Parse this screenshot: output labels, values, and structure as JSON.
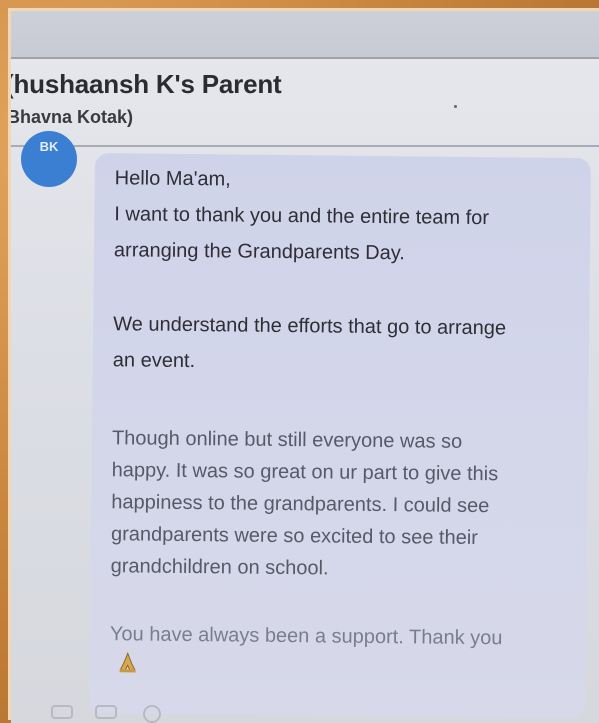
{
  "chat": {
    "name": "(hushaansh K's Parent",
    "subname": "Bhavna Kotak)",
    "avatar_initials": "BK"
  },
  "message": {
    "lines": [
      "Hello Ma'am,",
      "I want to thank you and the entire team for",
      "arranging the Grandparents Day.",
      "We understand the efforts that go to arrange",
      "an event.",
      "Though online but still everyone was so",
      "happy. It was so great on ur part to give this",
      "happiness to the grandparents. I could see",
      "grandparents were so excited to see their",
      "grandchildren on school.",
      "You have always been a support. Thank you"
    ],
    "emoji_icon": "folded-hands-icon"
  },
  "colors": {
    "frame": "#c9884a",
    "avatar": "#3a7fd1",
    "bubble": "#d1d5ea",
    "text": "#2d2e36"
  }
}
